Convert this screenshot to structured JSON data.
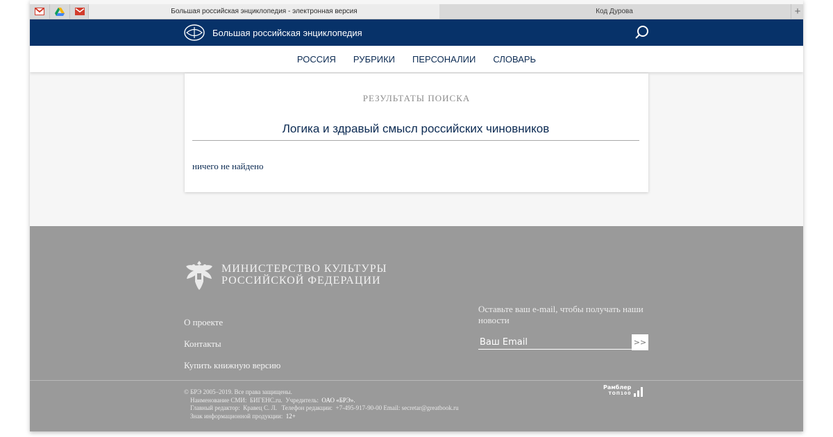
{
  "browser": {
    "tabs": [
      {
        "title": "Большая российская энциклопедия - электронная версия",
        "active": true
      },
      {
        "title": "Код Дурова",
        "active": false
      }
    ],
    "new_tab_label": "+",
    "pinned": [
      "gmail-icon",
      "google-drive-icon",
      "mail-icon"
    ]
  },
  "header": {
    "site_title": "Большая российская энциклопедия",
    "brand_color": "#073269"
  },
  "nav": {
    "items": [
      {
        "label": "РОССИЯ"
      },
      {
        "label": "РУБРИКИ"
      },
      {
        "label": "ПЕРСОНАЛИИ"
      },
      {
        "label": "СЛОВАРЬ"
      }
    ]
  },
  "results": {
    "heading": "РЕЗУЛЬТАТЫ ПОИСКА",
    "query": "Логика и здравый смысл российских чиновников",
    "empty_message": "ничего не найдено"
  },
  "footer": {
    "ministry_line1": "МИНИСТЕРСТВО КУЛЬТУРЫ",
    "ministry_line2": "РОССИЙСКОЙ ФЕДЕРАЦИИ",
    "links": [
      {
        "label": "О проекте"
      },
      {
        "label": "Контакты"
      },
      {
        "label": "Купить книжную версию"
      }
    ],
    "subscribe_text": "Оставьте ваш e-mail, чтобы получать наши новости",
    "email_placeholder": "Ваш Email",
    "submit_label": ">>",
    "legal": {
      "copyright": "© БРЭ 2005–2019. Все права защищены.",
      "media_label": "Наименование СМИ:",
      "media_value": "БИГЕНС.ru.",
      "founder_label": "Учредитель:",
      "founder_value": "ОАО «БРЭ».",
      "editor_label": "Главный редактор:",
      "editor_value": "Кравец С. Л.",
      "phone_label": "Телефон редакции:",
      "phone_value": "+7-495-917-90-00",
      "email_label": "Email:",
      "email_value": "secretar@greatbook.ru",
      "age_label": "Знак информационной продукции:",
      "age_value": "12+"
    },
    "rambler": {
      "line1": "Рамблер",
      "line2": "ТОП100"
    }
  }
}
